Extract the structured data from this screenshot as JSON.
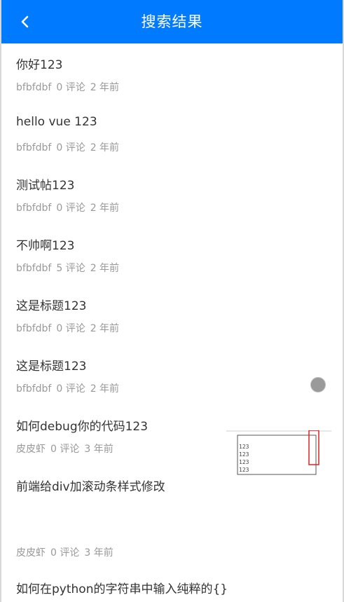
{
  "header": {
    "title": "搜索结果",
    "back_icon": "chevron-left-icon",
    "background": "#007bff"
  },
  "results": [
    {
      "title": "你好123",
      "author": "bfbfdbf",
      "comments": "0 评论",
      "time": "2 年前"
    },
    {
      "title": "hello vue 123",
      "author": "bfbfdbf",
      "comments": "0 评论",
      "time": "2 年前"
    },
    {
      "title": "测试帖123",
      "author": "bfbfdbf",
      "comments": "0 评论",
      "time": "2 年前"
    },
    {
      "title": "不帅啊123",
      "author": "bfbfdbf",
      "comments": "5 评论",
      "time": "2 年前"
    },
    {
      "title": "这是标题123",
      "author": "bfbfdbf",
      "comments": "0 评论",
      "time": "2 年前"
    },
    {
      "title": "这是标题123",
      "author": "bfbfdbf",
      "comments": "0 评论",
      "time": "2 年前"
    },
    {
      "title": "如何debug你的代码123",
      "author": "皮皮虾",
      "comments": "0 评论",
      "time": "3 年前"
    },
    {
      "title": "前端给div加滚动条样式修改",
      "author": "皮皮虾",
      "comments": "0 评论",
      "time": "3 年前",
      "thumbnail_lines": [
        "123",
        "123",
        "123",
        "123"
      ]
    },
    {
      "title": "如何在python的字符串中输入纯粹的{}",
      "author": "",
      "comments": "",
      "time": ""
    }
  ]
}
